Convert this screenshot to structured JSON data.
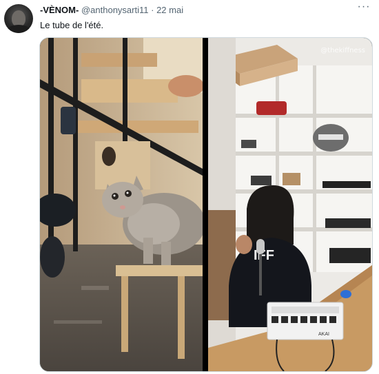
{
  "tweet": {
    "display_name": "-VÈNOM-",
    "handle": "@anthonysarti11",
    "separator": "·",
    "date": "22 mai",
    "text": "Le tube de l'été.",
    "more_icon": "more-horizontal-icon"
  },
  "media": {
    "watermark": "@thekiffness",
    "hoodie_text": "IFF",
    "controller_brand": "AKAI"
  }
}
